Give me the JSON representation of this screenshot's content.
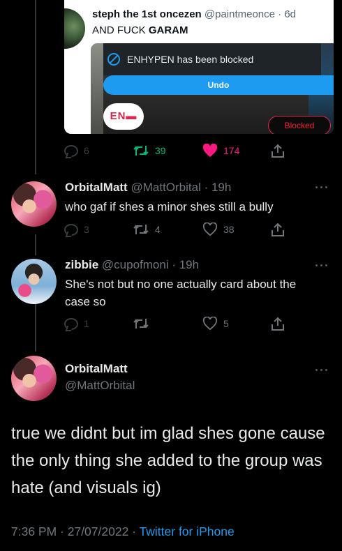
{
  "quoted_tweet": {
    "name": "steph the 1st oncezen",
    "handle_time": "@paintmeonce · 6d",
    "text_prefix": "AND FUCK ",
    "text_bold": "GARAM",
    "toast_message": "ENHYPEN has been blocked",
    "undo_label": "Undo",
    "logo_text": "EN",
    "blocked_label": "Blocked"
  },
  "top_actions": {
    "replies": "6",
    "retweets": "39",
    "likes": "174"
  },
  "replies": [
    {
      "name": "OrbitalMatt",
      "handle_time": "@MattOrbital · 19h",
      "text": "who gaf if shes a minor shes still a bully",
      "replies": "3",
      "retweets": "4",
      "likes": "38"
    },
    {
      "name": "zibbie",
      "handle_time": "@cupofmoni · 19h",
      "text": "She's not but no one actually card about the case so",
      "replies": "1",
      "retweets": "",
      "likes": "5"
    }
  ],
  "main_tweet": {
    "name": "OrbitalMatt",
    "handle": "@MattOrbital",
    "text": "true we didnt but im glad shes gone cause the only thing she added to the group was hate (and visuals ig)",
    "timestamp": "7:36 PM · 27/07/2022 · ",
    "source": "Twitter for iPhone"
  },
  "colors": {
    "like_red": "#f91880",
    "retweet_green": "#00ba7c",
    "link_blue": "#1d9bf0"
  }
}
